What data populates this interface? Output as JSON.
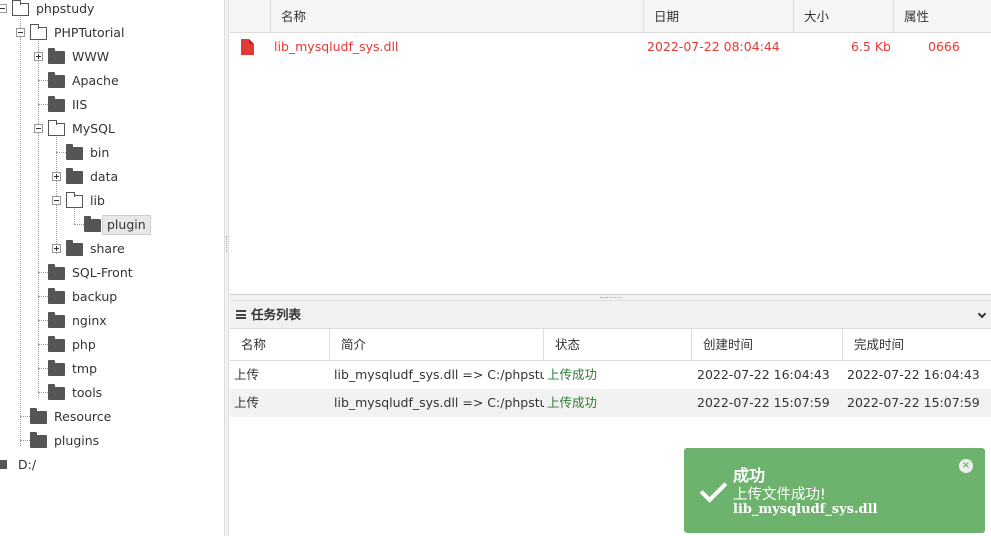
{
  "tree": {
    "root": "phpstudy",
    "phptutorial": "PHPTutorial",
    "www": "WWW",
    "apache": "Apache",
    "iis": "IIS",
    "mysql": "MySQL",
    "bin": "bin",
    "data": "data",
    "lib": "lib",
    "plugin": "plugin",
    "share": "share",
    "sqlfront": "SQL-Front",
    "backup": "backup",
    "nginx": "nginx",
    "php": "php",
    "tmp": "tmp",
    "tools": "tools",
    "resource": "Resource",
    "plugins": "plugins",
    "drive_d": "D:/"
  },
  "files": {
    "columns": {
      "name": "名称",
      "date": "日期",
      "size": "大小",
      "attr": "属性"
    },
    "rows": [
      {
        "name": "lib_mysqludf_sys.dll",
        "date": "2022-07-22 08:04:44",
        "size": "6.5 Kb",
        "attr": "0666"
      }
    ]
  },
  "tasks": {
    "title": "任务列表",
    "columns": {
      "name": "名称",
      "intro": "简介",
      "status": "状态",
      "created": "创建时间",
      "finished": "完成时间"
    },
    "rows": [
      {
        "name": "上传",
        "intro": "lib_mysqludf_sys.dll => C:/phpstudy",
        "status": "上传成功",
        "created": "2022-07-22 16:04:43",
        "finished": "2022-07-22 16:04:43"
      },
      {
        "name": "上传",
        "intro": "lib_mysqludf_sys.dll => C:/phpstudy",
        "status": "上传成功",
        "created": "2022-07-22 15:07:59",
        "finished": "2022-07-22 15:07:59"
      }
    ]
  },
  "toast": {
    "title": "成功",
    "message": "上传文件成功!",
    "filename": "lib_mysqludf_sys.dll",
    "close": "×",
    "color": "#6db36d"
  },
  "colors": {
    "error_red": "#e53935",
    "success_green": "#2e7d32"
  }
}
